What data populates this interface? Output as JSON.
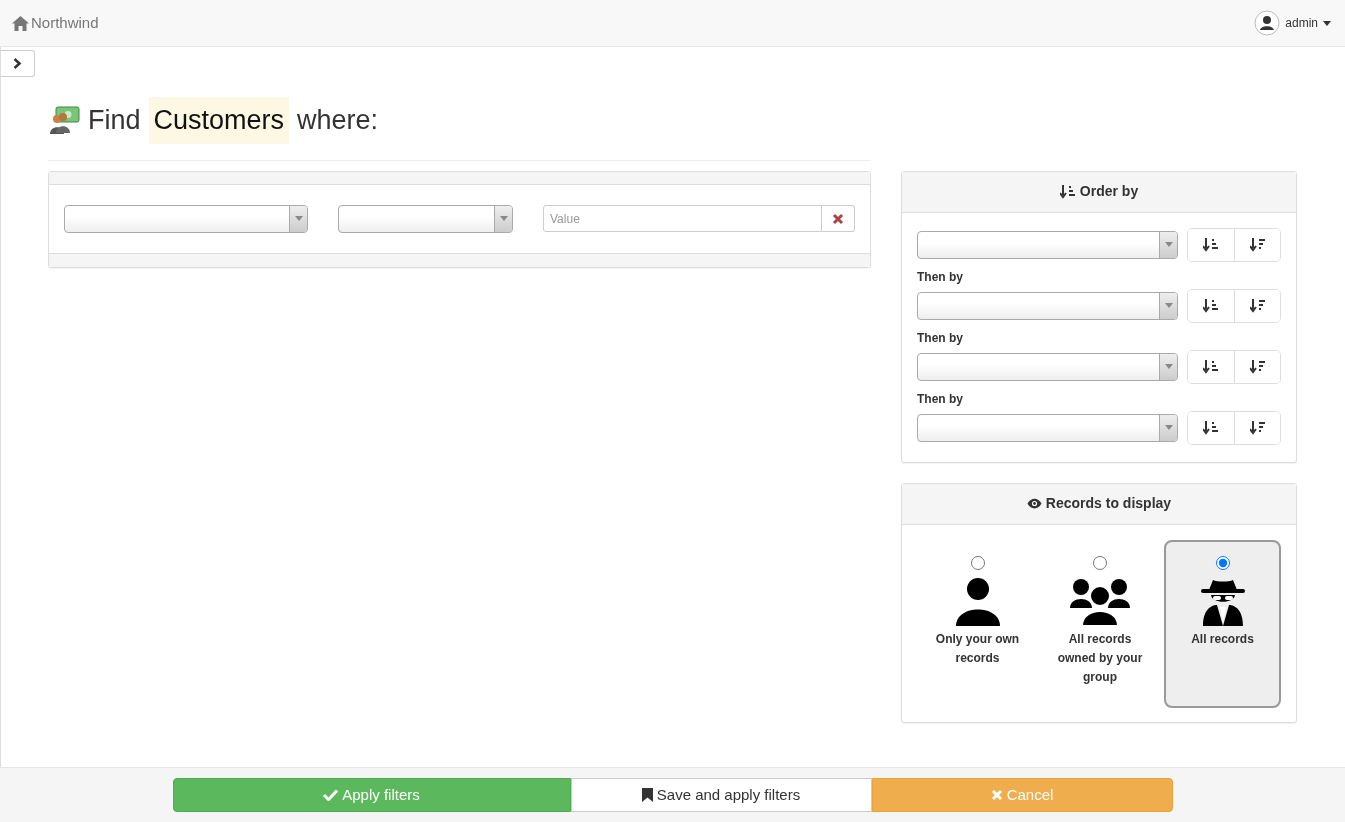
{
  "navbar": {
    "brand": "Northwind",
    "user": "admin"
  },
  "page_title": {
    "prefix": "Find",
    "entity": "Customers",
    "suffix": "where:"
  },
  "filter": {
    "value_placeholder": "Value"
  },
  "order_by": {
    "title": "Order by",
    "rows": [
      {
        "kind": "first"
      },
      {
        "kind": "then",
        "label": "Then by"
      },
      {
        "kind": "then",
        "label": "Then by"
      },
      {
        "kind": "then",
        "label": "Then by"
      }
    ]
  },
  "records": {
    "title": "Records to display",
    "options": [
      {
        "kind": "own",
        "label": "Only your own records",
        "selected": false
      },
      {
        "kind": "group",
        "label": "All records owned by your group",
        "selected": false
      },
      {
        "kind": "all",
        "label": "All records",
        "selected": true
      }
    ]
  },
  "actions": [
    {
      "kind": "apply",
      "label": "Apply filters"
    },
    {
      "kind": "save",
      "label": "Save and apply filters"
    },
    {
      "kind": "cancel",
      "label": "Cancel"
    }
  ]
}
